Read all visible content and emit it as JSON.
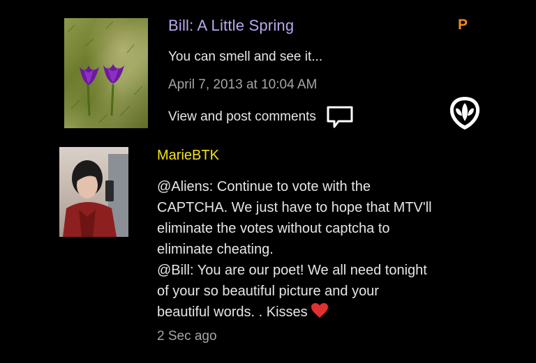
{
  "post": {
    "title": "Bill: A Little Spring",
    "badge": "P",
    "excerpt": "You can smell and see it...",
    "date": "April 7, 2013 at 10:04 AM",
    "comments_link": "View and post comments",
    "icons": {
      "comments": "speech-bubble-icon",
      "logo": "alien-head-icon"
    },
    "colors": {
      "title": "#b9a9ee",
      "badge": "#f28a1d"
    }
  },
  "comment": {
    "author": "MarieBTK",
    "lines": [
      "@Aliens: Continue to vote with the",
      "CAPTCHA. We just have to hope that MTV'll",
      "eliminate the votes without captcha to",
      "eliminate cheating.",
      "@Bill: You are our poet! We all need tonight",
      "of your so beautiful picture and your",
      "beautiful words. . Kisses"
    ],
    "time": "2 Sec ago",
    "icons": {
      "heart": "heart-icon"
    },
    "colors": {
      "author": "#f2e21c"
    }
  }
}
